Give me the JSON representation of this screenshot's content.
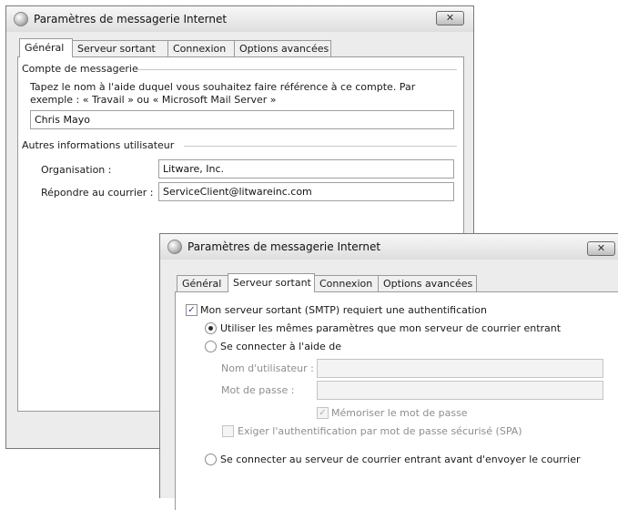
{
  "back_window": {
    "title": "Paramètres de messagerie Internet",
    "close_label": "✕",
    "tabs": [
      "Général",
      "Serveur sortant",
      "Connexion",
      "Options avancées"
    ],
    "account_section": {
      "legend": "Compte de messagerie",
      "description_line1": "Tapez le nom à l'aide duquel vous souhaitez faire référence à ce compte. Par",
      "description_line2": "exemple : « Travail » ou « Microsoft Mail Server »",
      "account_name": "Chris Mayo"
    },
    "user_section": {
      "legend": "Autres informations utilisateur",
      "organization_label": "Organisation :",
      "organization_value": "Litware, Inc.",
      "reply_label": "Répondre au courrier :",
      "reply_value": "ServiceClient@litwareinc.com"
    }
  },
  "front_window": {
    "title": "Paramètres de messagerie Internet",
    "close_label": "✕",
    "tabs": [
      "Général",
      "Serveur sortant",
      "Connexion",
      "Options avancées"
    ],
    "smtp_auth_label": "Mon serveur sortant (SMTP) requiert une authentification",
    "smtp_auth_checked": true,
    "same_settings_label": "Utiliser les mêmes paramètres que mon serveur de courrier entrant",
    "connect_with_label": "Se connecter à l'aide de",
    "username_label": "Nom d'utilisateur :",
    "username_value": "",
    "password_label": "Mot de passe :",
    "password_value": "",
    "remember_label": "Mémoriser le mot de passe",
    "remember_checked": true,
    "spa_label": "Exiger l'authentification par mot de passe sécurisé (SPA)",
    "spa_checked": false,
    "incoming_first_label": "Se connecter au serveur de courrier entrant avant d'envoyer le courrier",
    "selected_option": "same_settings"
  }
}
